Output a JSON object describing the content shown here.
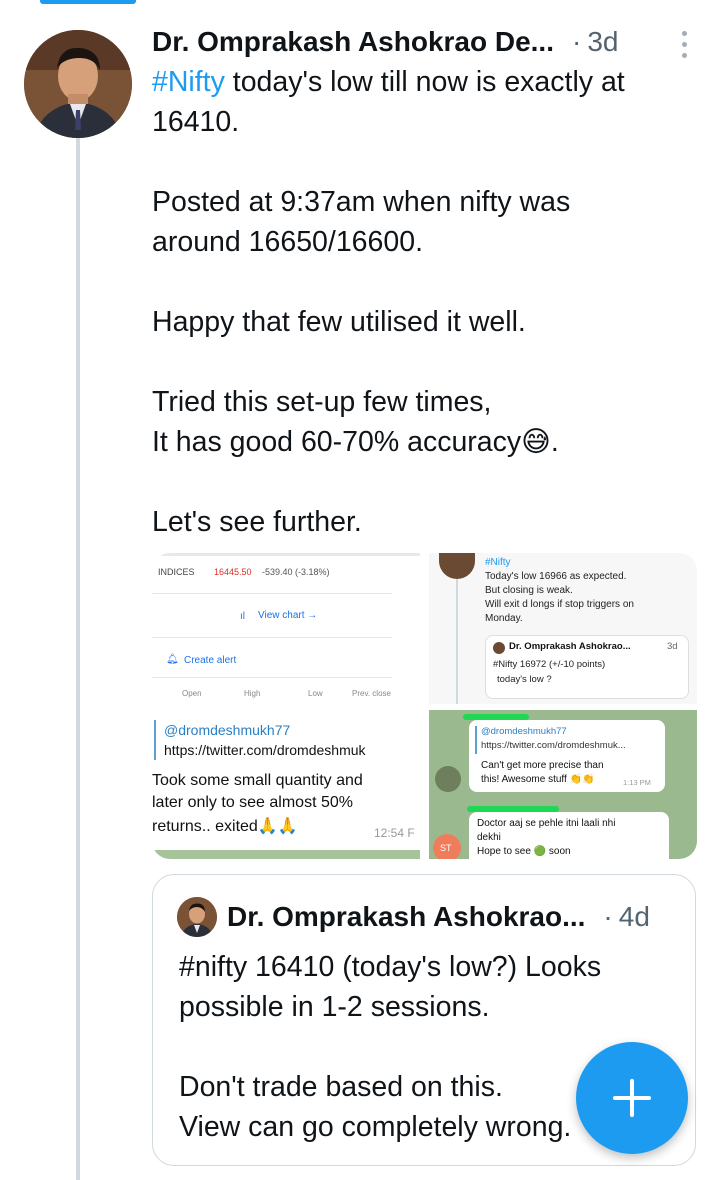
{
  "tweet": {
    "author": "Dr. Omprakash Ashokrao De...",
    "time": "3d",
    "hashtag": "#Nifty",
    "line1_rest": " today's low till now is exactly at",
    "line2": "16410.",
    "line3": "Posted at 9:37am when nifty was",
    "line4": "around 16650/16600.",
    "line5": "Happy that few utilised it well.",
    "line6": "Tried this set-up few times,",
    "line7": "It has good 60-70% accuracy😅.",
    "line8": "Let's see further."
  },
  "media": {
    "img1": {
      "indices": "INDICES",
      "price": "16445.50",
      "change": "-539.40 (-3.18%)",
      "view_chart": "View chart →",
      "create_alert": "Create alert",
      "cols": [
        "Open",
        "High",
        "Low",
        "Prev. close"
      ]
    },
    "img2": {
      "hashtag": "#Nifty",
      "line1": "Today's low 16966 as expected.",
      "line2": "But closing is weak.",
      "line3": "Will exit d longs if stop triggers on",
      "line4": "Monday.",
      "quote_author": "Dr. Omprakash Ashokrao...",
      "quote_time": "3d",
      "quote_line1": "#Nifty 16972 (+/-10 points)",
      "quote_line2": "today's low ?"
    },
    "img3": {
      "handle": "@dromdeshmukh77",
      "url": "https://twitter.com/dromdeshmuk",
      "line1": "Took some small quantity and",
      "line2": "later only to see almost 50%",
      "line3": "returns.. exited🙏🙏",
      "time": "12:54 F"
    },
    "img4": {
      "handle": "@dromdeshmukh77",
      "url": "https://twitter.com/dromdeshmuk...",
      "line1": "Can't get more precise than",
      "line2": "this! Awesome stuff 👏👏",
      "time": "1:13 PM",
      "line3": "Doctor aaj se pehle itni laali nhi",
      "line4": "dekhi",
      "line5": "Hope to see 🟢 soon",
      "avatar_initials": "ST"
    }
  },
  "quote": {
    "author": "Dr. Omprakash Ashokrao...",
    "time": "4d",
    "line1": "#nifty 16410 (today's low?) Looks",
    "line2": "possible in 1-2 sessions.",
    "line3": "Don't trade based on this.",
    "line4": "View can go completely wrong."
  },
  "colors": {
    "accent": "#1d9bf0",
    "thread_line": "#cfd9de",
    "price_red": "#d93025"
  },
  "icons": {
    "more": "more-vertical-icon",
    "compose": "plus-icon",
    "chart": "bar-chart-icon",
    "alert": "bell-icon"
  }
}
